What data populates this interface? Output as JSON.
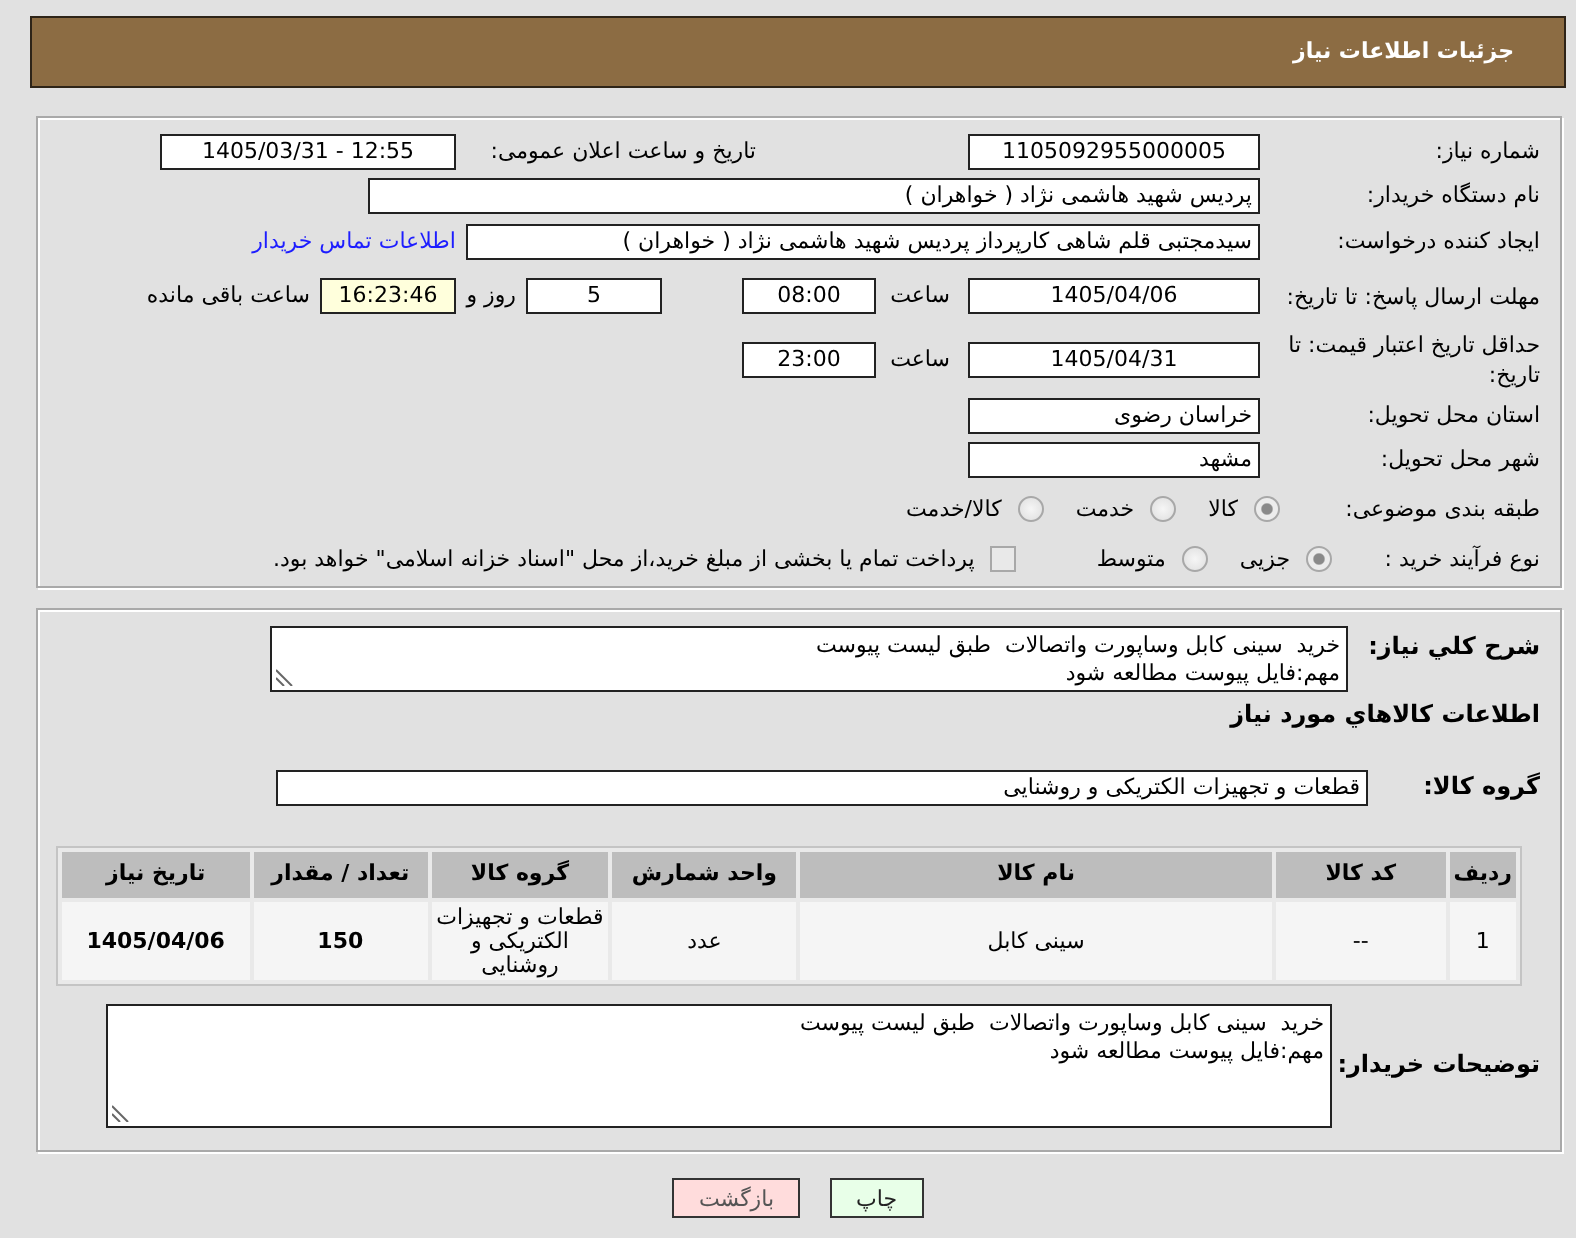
{
  "header": {
    "title": "جزئیات اطلاعات نیاز"
  },
  "details": {
    "need_number": {
      "label": "شماره نیاز:",
      "value": "1105092955000005"
    },
    "announce": {
      "label": "تاریخ و ساعت اعلان عمومی:",
      "value": "1405/03/31 - 12:55"
    },
    "buyer_org": {
      "label": "نام دستگاه خریدار:",
      "value": "پردیس شهید هاشمی نژاد ( خواهران )"
    },
    "requester": {
      "label": "ایجاد کننده درخواست:",
      "value": "سیدمجتبی قلم شاهی کارپرداز پردیس شهید هاشمی نژاد ( خواهران )",
      "link": "اطلاعات تماس خریدار"
    },
    "reply_deadline": {
      "label": "مهلت ارسال پاسخ: تا تاریخ:",
      "date": "1405/04/06",
      "time_label": "ساعت",
      "time": "08:00",
      "days": "5",
      "days_label": "روز و",
      "remaining": "16:23:46",
      "remaining_label": "ساعت باقی مانده"
    },
    "price_validity": {
      "label": "حداقل تاریخ اعتبار قیمت: تا تاریخ:",
      "date": "1405/04/31",
      "time_label": "ساعت",
      "time": "23:00"
    },
    "province": {
      "label": "استان محل تحویل:",
      "value": "خراسان رضوی"
    },
    "city": {
      "label": "شهر محل تحویل:",
      "value": "مشهد"
    },
    "category": {
      "label": "طبقه بندی موضوعی:",
      "options": [
        {
          "label": "کالا",
          "selected": true,
          "disabled": true
        },
        {
          "label": "خدمت",
          "selected": false,
          "disabled": true
        },
        {
          "label": "کالا/خدمت",
          "selected": false,
          "disabled": true
        }
      ]
    },
    "process": {
      "label": "نوع فرآیند خرید :",
      "options": [
        {
          "label": "جزیی",
          "selected": true,
          "disabled": true
        },
        {
          "label": "متوسط",
          "selected": false,
          "disabled": true
        }
      ],
      "treasury": {
        "label": "پرداخت تمام یا بخشی از مبلغ خرید،از محل \"اسناد خزانه اسلامی\" خواهد بود.",
        "checked": false,
        "disabled": true
      }
    }
  },
  "goods": {
    "description": {
      "label": "شرح کلي نياز:",
      "value": "خرید  سینی کابل وساپورت واتصالات  طبق لیست پیوست\nمهم:فایل پیوست مطالعه شود"
    },
    "section_title": "اطلاعات كالاهاي مورد نياز",
    "group": {
      "label": "گروه کالا:",
      "value": "قطعات و تجهیزات الکتریکی و روشنایی"
    },
    "table": {
      "columns": [
        "ردیف",
        "کد کالا",
        "نام کالا",
        "واحد شمارش",
        "گروه کالا",
        "تعداد / مقدار",
        "تاریخ نیاز"
      ],
      "rows": [
        [
          "1",
          "--",
          "سینی کابل",
          "عدد",
          "قطعات و تجهیزات الکتریکی و روشنایی",
          "150",
          "1405/04/06"
        ]
      ]
    },
    "buyer_notes": {
      "label": "توضیحات خریدار:",
      "value": "خرید  سینی کابل وساپورت واتصالات  طبق لیست پیوست\nمهم:فایل پیوست مطالعه شود"
    }
  },
  "buttons": [
    {
      "label": "چاپ",
      "kind": "print"
    },
    {
      "label": "بازگشت",
      "kind": "back"
    }
  ]
}
